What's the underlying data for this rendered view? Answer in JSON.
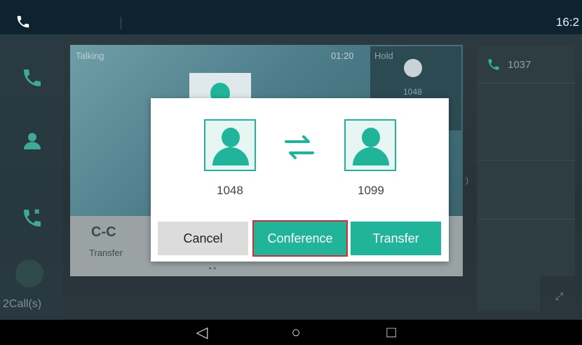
{
  "status_bar": {
    "time": "16:2"
  },
  "nav": {
    "calls_count_label": "2Call(s)"
  },
  "call_view": {
    "talking_label": "Talking",
    "talking_duration": "01:20",
    "hold_label": "Hold",
    "hold_number": "1048",
    "function_transfer_label": "Transfer"
  },
  "right_panel": {
    "line_number": "1037"
  },
  "dialog": {
    "left_party": "1048",
    "right_party": "1099",
    "cancel_label": "Cancel",
    "conference_label": "Conference",
    "transfer_label": "Transfer"
  },
  "android_nav": {
    "back": "◁",
    "home": "○",
    "recents": "□"
  },
  "colors": {
    "accent": "#20b49a",
    "highlight": "#d32f2f"
  }
}
